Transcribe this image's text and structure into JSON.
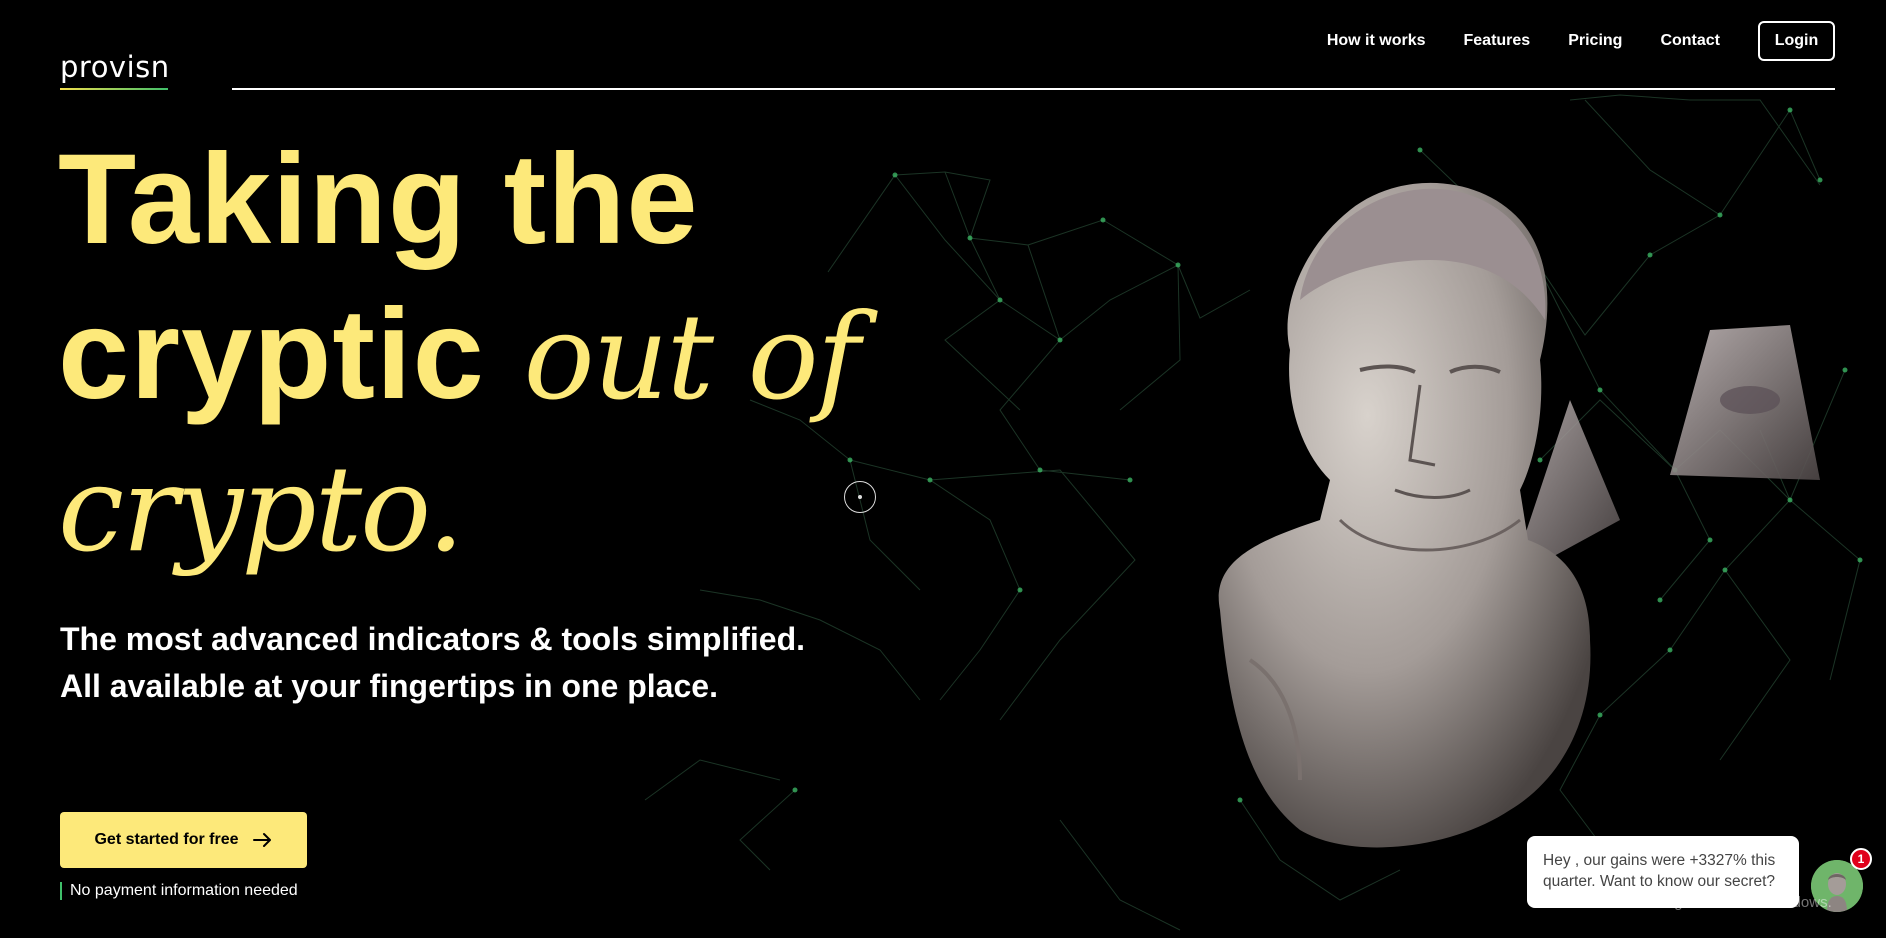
{
  "brand": {
    "name": "provisn"
  },
  "nav": {
    "links": [
      "How it works",
      "Features",
      "Pricing",
      "Contact"
    ],
    "login_label": "Login"
  },
  "hero": {
    "title_line1": "Taking the",
    "title_line2_sans": "cryptic",
    "title_line2_italic": "out of",
    "title_line3_italic": "crypto.",
    "subtitle": "The most advanced indicators & tools simplified. All available at your fingertips in one place.",
    "cta_label": "Get started for free",
    "cta_arrow_icon": "arrow-right-icon",
    "note": "No payment information needed"
  },
  "chat": {
    "message": "Hey , our gains were +3327% this quarter. Want to know our secret?",
    "badge_count": "1"
  },
  "watermark": {
    "text": "Go to Settings to activate Windows."
  },
  "colors": {
    "accent_yellow": "#fde97a",
    "accent_green": "#3fbf6a",
    "background": "#000000",
    "badge_red": "#e0001b"
  }
}
